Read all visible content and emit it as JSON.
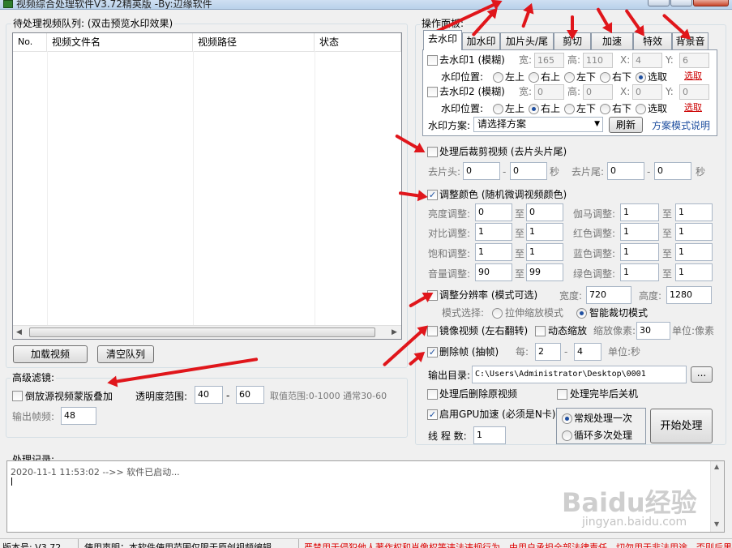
{
  "window": {
    "title": "视频综合处理软件V3.72精英版 -By:辺缘软件"
  },
  "queue": {
    "title": "待处理视频队列: (双击预览水印效果)",
    "columns": [
      "No.",
      "视频文件名",
      "视频路径",
      "状态"
    ],
    "load_btn": "加载视频",
    "clear_btn": "清空队列"
  },
  "advanced": {
    "title": "高级滤镜:",
    "reverse_overlay": "倒放源视频蒙版叠加",
    "opacity_label": "透明度范围:",
    "opacity_from": "40",
    "opacity_dash": "-",
    "opacity_to": "60",
    "range_hint": "取值范围:0-1000 通常30-60",
    "fps_label": "输出帧频:",
    "fps_value": "48"
  },
  "panel": {
    "title": "操作面板:",
    "tabs": [
      "去水印",
      "加水印",
      "加片头/尾",
      "剪切",
      "加速",
      "特效",
      "背景音"
    ],
    "wm1": {
      "label": "去水印1 (模糊)",
      "w_label": "宽:",
      "w": "165",
      "h_label": "高:",
      "h": "110",
      "x_label": "X:",
      "x": "4",
      "y_label": "Y:",
      "y": "6",
      "pos_label": "水印位置:",
      "select": "选取"
    },
    "wm2": {
      "label": "去水印2 (模糊)",
      "w_label": "宽:",
      "w": "0",
      "h_label": "高:",
      "h": "0",
      "x_label": "X:",
      "x": "0",
      "y_label": "Y:",
      "y": "0",
      "pos_label": "水印位置:",
      "select": "选取"
    },
    "positions": [
      "左上",
      "右上",
      "左下",
      "右下",
      "选取"
    ],
    "scheme_label": "水印方案:",
    "scheme_value": "请选择方案",
    "refresh": "刷新",
    "scheme_help": "方案模式说明"
  },
  "trim": {
    "label": "处理后裁剪视频 (去片头片尾)",
    "head_label": "去片头:",
    "head_from": "0",
    "head_to": "0",
    "tail_label": "去片尾:",
    "tail_from": "0",
    "tail_to": "0",
    "dash": "-",
    "sec": "秒"
  },
  "color": {
    "label": "调整颜色 (随机微调视频颜色)",
    "to": "至",
    "rows": [
      {
        "l1": "亮度调整:",
        "a1": "0",
        "b1": "0",
        "l2": "伽马调整:",
        "a2": "1",
        "b2": "1"
      },
      {
        "l1": "对比调整:",
        "a1": "1",
        "b1": "1",
        "l2": "红色调整:",
        "a2": "1",
        "b2": "1"
      },
      {
        "l1": "饱和调整:",
        "a1": "1",
        "b1": "1",
        "l2": "蓝色调整:",
        "a2": "1",
        "b2": "1"
      },
      {
        "l1": "音量调整:",
        "a1": "90",
        "b1": "99",
        "l2": "绿色调整:",
        "a2": "1",
        "b2": "1"
      }
    ]
  },
  "resolution": {
    "label": "调整分辨率 (模式可选)",
    "width_label": "宽度:",
    "width": "720",
    "height_label": "高度:",
    "height": "1280",
    "mode_label": "模式选择:",
    "mode1": "拉伸缩放模式",
    "mode2": "智能裁切模式"
  },
  "mirror": {
    "label": "镜像视频 (左右翻转)",
    "zoom_label": "动态缩放",
    "zoom_px_label": "缩放像素:",
    "zoom_px": "30",
    "unit": "单位:像素"
  },
  "frames": {
    "label": "删除帧 (抽帧)",
    "each_label": "每:",
    "from": "2",
    "dash": "-",
    "to": "4",
    "unit": "单位:秒"
  },
  "output": {
    "dir_label": "输出目录:",
    "dir": "C:\\Users\\Administrator\\Desktop\\0001",
    "browse": "...",
    "del_src": "处理后删除原视频",
    "shutdown": "处理完毕后关机",
    "gpu": "启用GPU加速 (必须是N卡)",
    "threads_label": "线 程 数:",
    "threads": "1",
    "once": "常规处理一次",
    "loop": "循环多次处理",
    "start": "开始处理"
  },
  "log": {
    "title": "处理记录:",
    "line": "2020-11-1 11:53:02 -->> 软件已启动..."
  },
  "status": {
    "version": "版本号: V3.72",
    "notice": "使用声明：本软件使用范围仅限于原创视频编辑",
    "warning": "严禁用于侵犯他人著作权和肖像权等违法违规行为，由用户承担全部法律责任，切勿用于非法用途，否则后果自负"
  },
  "watermark": {
    "brand": "Baidu经验",
    "url": "jingyan.baidu.com"
  }
}
